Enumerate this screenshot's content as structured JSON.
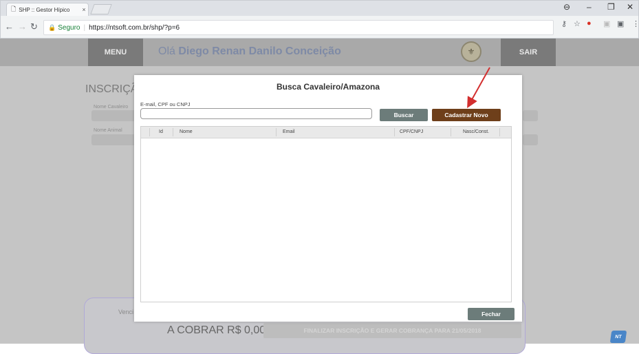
{
  "browser": {
    "tab_title": "SHP :: Gestor Hípico",
    "tab_close": "×",
    "secure_label": "Seguro",
    "url": "https://ntsoft.com.br/shp/?p=6"
  },
  "header": {
    "menu_label": "MENU",
    "greeting_prefix": "Olá",
    "user_name": "Diego Renan Danilo Conceição",
    "sair_label": "SAIR"
  },
  "background": {
    "title": "INSCRIÇÃ",
    "field1_label": "Nome Cavaleiro",
    "field2_label": "Nome Animal",
    "venc_label": "Venci",
    "cobrar_text": "A COBRAR R$ 0,00",
    "finalizar_label": "FINALIZAR INSCRIÇÃO E GERAR COBRANÇA PARA 21/05/2018",
    "nt_badge": "NT"
  },
  "modal": {
    "title": "Busca Cavaleiro/Amazona",
    "search_label": "E-mail, CPF ou CNPJ",
    "search_value": "",
    "buscar_label": "Buscar",
    "cadastrar_label": "Cadastrar Novo",
    "columns": [
      "Id",
      "Nome",
      "Email",
      "CPF/CNPJ",
      "Nasc/Const."
    ],
    "fechar_label": "Fechar"
  },
  "colors": {
    "cadastrar": "#6e3f1a",
    "buscar": "#6c7c7a",
    "annotation_arrow": "#d32f2f"
  }
}
